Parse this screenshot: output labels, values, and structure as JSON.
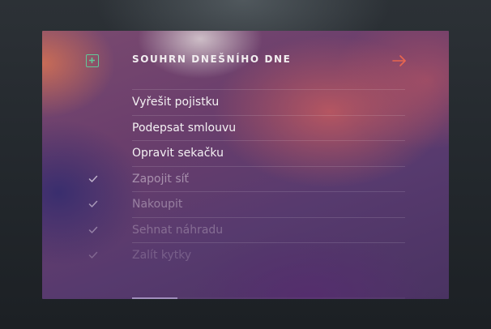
{
  "header": {
    "title": "SOUHRN DNEŠNÍHO DNE",
    "add_icon": "plus-square-icon",
    "next_icon": "arrow-right-icon"
  },
  "tasks": [
    {
      "label": "Vyřešit pojistku",
      "done": false
    },
    {
      "label": "Podepsat smlouvu",
      "done": false
    },
    {
      "label": "Opravit sekačku",
      "done": false
    },
    {
      "label": "Zapojit síť",
      "done": true
    },
    {
      "label": "Nakoupit",
      "done": true
    },
    {
      "label": "Sehnat náhradu",
      "done": true
    },
    {
      "label": "Zalít kytky",
      "done": true
    }
  ],
  "colors": {
    "accent_green": "#62c99a",
    "accent_orange": "#e8664f",
    "text_primary": "#f4f1f3"
  },
  "icons": {
    "check": "check-icon"
  }
}
